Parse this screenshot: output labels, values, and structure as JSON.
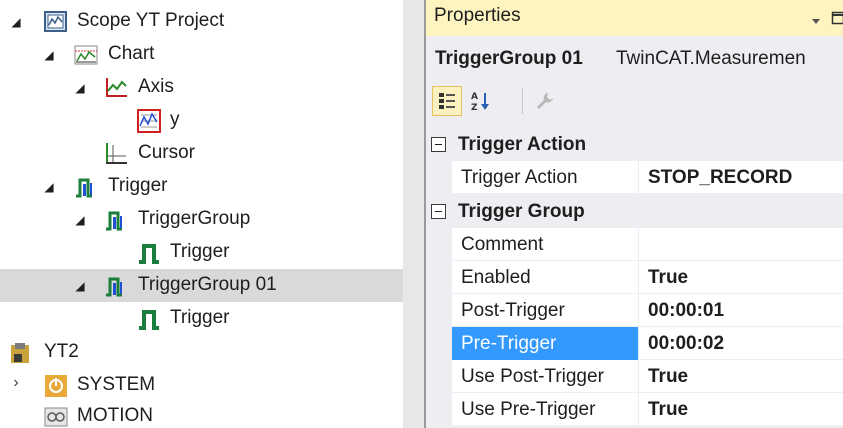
{
  "tree": {
    "items": [
      {
        "label": "Scope YT Project",
        "icon": "scope-project-icon",
        "expander": "expanded"
      },
      {
        "label": "Chart",
        "icon": "chart-icon",
        "expander": "expanded"
      },
      {
        "label": "Axis",
        "icon": "axis-icon",
        "expander": "expanded"
      },
      {
        "label": "y",
        "icon": "channel-icon",
        "expander": "none"
      },
      {
        "label": "Cursor",
        "icon": "cursor-icon",
        "expander": "none"
      },
      {
        "label": "Trigger",
        "icon": "trigger-folder-icon",
        "expander": "expanded"
      },
      {
        "label": "TriggerGroup",
        "icon": "trigger-group-icon",
        "expander": "expanded"
      },
      {
        "label": "Trigger",
        "icon": "trigger-icon",
        "expander": "none"
      },
      {
        "label": "TriggerGroup 01",
        "icon": "trigger-group-icon",
        "expander": "expanded",
        "selected": true
      },
      {
        "label": "Trigger",
        "icon": "trigger-icon",
        "expander": "none"
      },
      {
        "label": "YT2",
        "icon": "yt-project-icon",
        "expander": "none"
      },
      {
        "label": "SYSTEM",
        "icon": "system-icon",
        "expander": "collapsed"
      },
      {
        "label": "MOTION",
        "icon": "motion-icon",
        "expander": "none"
      }
    ]
  },
  "properties": {
    "title": "Properties",
    "object_name": "TriggerGroup 01",
    "object_type": "TwinCAT.Measuremen",
    "toolbar": {
      "categorized": "categorized-icon",
      "alphabetical": "alphabetical-icon",
      "property_pages": "wrench-icon"
    },
    "categories": [
      {
        "label": "Trigger Action",
        "rows": [
          {
            "name": "Trigger Action",
            "value": "STOP_RECORD"
          }
        ]
      },
      {
        "label": "Trigger Group",
        "rows": [
          {
            "name": "Comment",
            "value": ""
          },
          {
            "name": "Enabled",
            "value": "True"
          },
          {
            "name": "Post-Trigger",
            "value": "00:00:01"
          },
          {
            "name": "Pre-Trigger",
            "value": "00:00:02",
            "selected": true
          },
          {
            "name": "Use Post-Trigger",
            "value": "True"
          },
          {
            "name": "Use Pre-Trigger",
            "value": "True"
          }
        ]
      }
    ]
  },
  "colors": {
    "selection": "#3399ff",
    "tree_selected": "#d9d9db",
    "title_bar": "#fdf4bf",
    "trigger_green": "#1a7f3c"
  }
}
